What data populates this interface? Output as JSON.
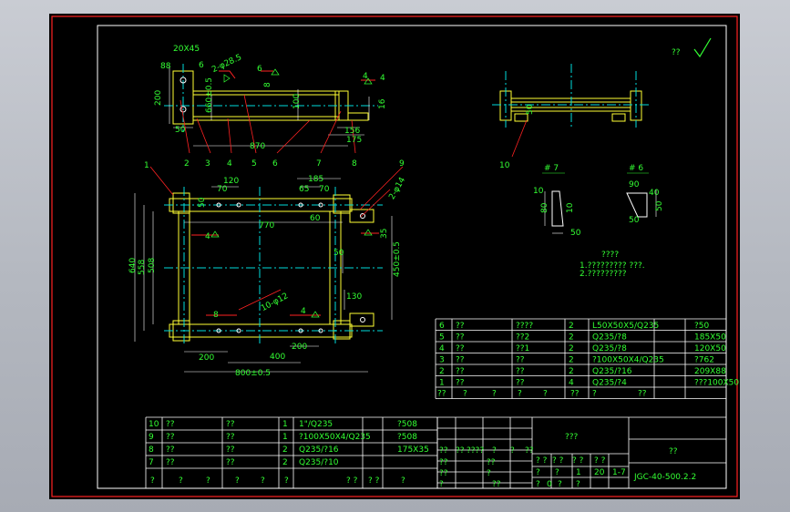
{
  "colors": {
    "viewport_bg": "#000000",
    "frame": "#ff2222",
    "part_outline": "#ffff33",
    "dimension": "#ffffff",
    "text": "#33ff33",
    "centerline": "#00dddd",
    "border_line": "#ffffff"
  },
  "top_right_mark": "??",
  "dims": {
    "d88": "88",
    "d20x45": "20X45",
    "d200": "200",
    "d6": "6",
    "d2_phi28": "2-φ28.5",
    "d8": "8",
    "d6b": "6",
    "d4": "4",
    "d4b": "4",
    "d660": "660±0.5",
    "d100": "100",
    "d16": "16",
    "d50": "50",
    "d156": "156",
    "d175": "175",
    "d870": "870",
    "d120": "120",
    "d70": "70",
    "d185": "185",
    "d65": "65",
    "d70b": "70",
    "d50b": "50",
    "d770": "770",
    "d60": "60",
    "d2_phi14": "2-φ14",
    "d35": "35",
    "d640": "640",
    "d558": "558",
    "d508": "508",
    "d4b2": "4",
    "d50c": "50",
    "d450": "450±0.5",
    "d130": "130",
    "d8b": "8",
    "d10phi": "10-φ12",
    "d4c": "4",
    "d200b": "200",
    "d200c": "200",
    "d400": "400",
    "d800": "800±0.5",
    "d10": "10",
    "d80": "80",
    "d10b": "10",
    "d50d": "50",
    "d90": "90",
    "d40": "40",
    "d50e": "50",
    "d50f": "50"
  },
  "balloons": [
    "1",
    "2",
    "3",
    "4",
    "5",
    "6",
    "7",
    "8",
    "9",
    "10"
  ],
  "section_labels": {
    "s7": "# 7",
    "s6": "# 6"
  },
  "notes": {
    "title": "????",
    "line1": "1.????????? ???.",
    "line2": "2.?????????"
  },
  "bom_upper": {
    "rows": [
      [
        "6",
        "??",
        "????",
        "2",
        "L50X50X5/Q235",
        "",
        "?50"
      ],
      [
        "5",
        "??",
        "??2",
        "2",
        "Q235/?8",
        "",
        "185X50"
      ],
      [
        "4",
        "??",
        "??1",
        "2",
        "Q235/?8",
        "",
        "120X50"
      ],
      [
        "3",
        "??",
        "??",
        "2",
        "?100X50X4/Q235",
        "",
        "?762"
      ],
      [
        "2",
        "??",
        "??",
        "2",
        "Q235/?16",
        "",
        "209X88"
      ],
      [
        "1",
        "??",
        "??",
        "4",
        "Q235/?4",
        "",
        "???100X50"
      ]
    ],
    "header": [
      "??",
      "?",
      "?",
      "?",
      "?",
      "??",
      "?",
      "??"
    ]
  },
  "bom_lower": {
    "rows": [
      [
        "10",
        "??",
        "??",
        "1",
        "1\"/Q235",
        "",
        "?508"
      ],
      [
        "9",
        "??",
        "??",
        "1",
        "?100X50X4/Q235",
        "",
        "?508"
      ],
      [
        "8",
        "??",
        "??",
        "2",
        "Q235/?16",
        "",
        "175X35"
      ],
      [
        "7",
        "??",
        "??",
        "2",
        "Q235/?10",
        "",
        ""
      ]
    ],
    "header": [
      "?",
      "?",
      "?",
      "?",
      "?",
      "?",
      "? ?",
      "? ?",
      "?"
    ]
  },
  "title_block": {
    "drawing_title": "???",
    "company": "??",
    "drawing_number": "JGC-40-500.2.2",
    "small_cells": [
      "??",
      "??",
      "????",
      "?",
      "?",
      "??",
      "??",
      "??",
      "?",
      "??",
      "?",
      "??"
    ],
    "stage_cells": [
      "? ?",
      "? ?",
      "? ?",
      "? ?"
    ],
    "qty_cells": [
      "?",
      "?",
      "1",
      "20",
      "1-7"
    ],
    "bottom_cells": [
      "?",
      "0",
      "?",
      "?"
    ]
  }
}
